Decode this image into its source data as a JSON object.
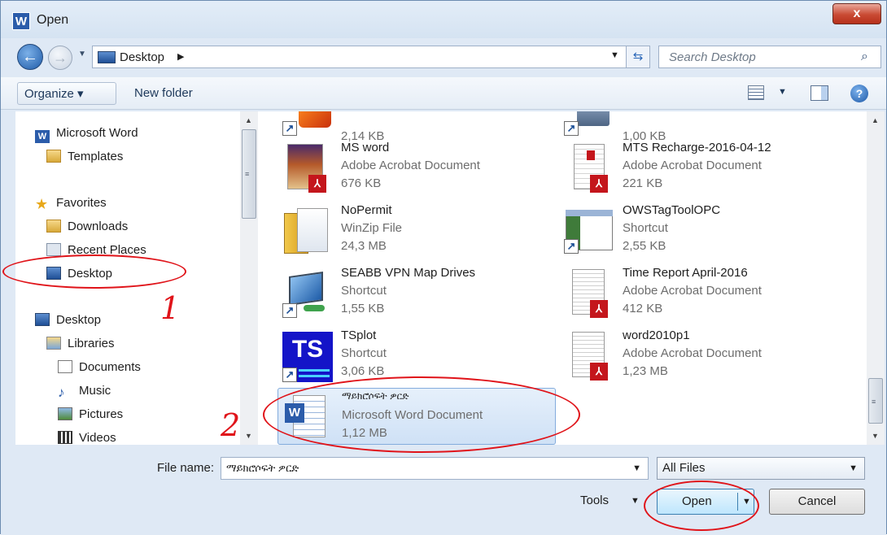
{
  "window": {
    "title": "Open",
    "app_icon_letter": "W",
    "close_symbol": "x"
  },
  "navigation": {
    "back_icon": "arrow-left",
    "forward_icon": "arrow-right",
    "address_path": "Desktop",
    "search_placeholder": "Search Desktop"
  },
  "toolbar": {
    "organize_label": "Organize ▾",
    "new_folder_label": "New folder"
  },
  "nav_tree": {
    "items": [
      {
        "label": "Microsoft Word",
        "icon": "word-app-icon"
      },
      {
        "label": "Templates",
        "icon": "folder-icon"
      },
      {
        "label": "Favorites",
        "icon": "star-icon"
      },
      {
        "label": "Downloads",
        "icon": "downloads-folder-icon"
      },
      {
        "label": "Recent Places",
        "icon": "recent-places-icon"
      },
      {
        "label": "Desktop",
        "icon": "desktop-icon",
        "selected": true
      },
      {
        "label": "Desktop",
        "icon": "desktop-icon"
      },
      {
        "label": "Libraries",
        "icon": "libraries-icon"
      },
      {
        "label": "Documents",
        "icon": "documents-icon"
      },
      {
        "label": "Music",
        "icon": "music-icon"
      },
      {
        "label": "Pictures",
        "icon": "pictures-icon"
      },
      {
        "label": "Videos",
        "icon": "videos-icon"
      }
    ]
  },
  "files": {
    "left": [
      {
        "name": "",
        "type": "",
        "size": "2,14 KB",
        "icon": "shortcut-icon"
      },
      {
        "name": "MS word",
        "type": "Adobe Acrobat Document",
        "size": "676 KB",
        "icon": "pdf-icon"
      },
      {
        "name": "NoPermit",
        "type": "WinZip File",
        "size": "24,3 MB",
        "icon": "winzip-icon"
      },
      {
        "name": "SEABB VPN Map Drives",
        "type": "Shortcut",
        "size": "1,55 KB",
        "icon": "network-shortcut-icon"
      },
      {
        "name": "TSplot",
        "type": "Shortcut",
        "size": "3,06 KB",
        "icon": "tsplot-icon"
      },
      {
        "name": "ማይክሮሶፍት ዎርድ",
        "type": "Microsoft Word Document",
        "size": "1,12 MB",
        "icon": "word-document-icon",
        "selected": true
      }
    ],
    "right": [
      {
        "name": "",
        "type": "",
        "size": "1,00 KB",
        "icon": "shortcut-icon"
      },
      {
        "name": "MTS Recharge-2016-04-12",
        "type": "Adobe Acrobat Document",
        "size": "221 KB",
        "icon": "pdf-icon"
      },
      {
        "name": "OWSTagToolOPC",
        "type": "Shortcut",
        "size": "2,55 KB",
        "icon": "app-shortcut-icon"
      },
      {
        "name": "Time Report April-2016",
        "type": "Adobe Acrobat Document",
        "size": "412 KB",
        "icon": "pdf-icon"
      },
      {
        "name": "word2010p1",
        "type": "Adobe Acrobat Document",
        "size": "1,23 MB",
        "icon": "pdf-icon"
      }
    ],
    "tsplot_badge": "TS",
    "pdf_badge": "⅄",
    "shortcut_arrow": "↗",
    "word_badge": "W"
  },
  "bottom": {
    "file_name_label": "File name:",
    "file_name_value": "ማይክሮሶፍት ዎርድ",
    "filter_value": "All Files",
    "tools_label": "Tools",
    "open_label": "Open",
    "cancel_label": "Cancel"
  },
  "annotations": {
    "mark_1": "1",
    "mark_2": "2",
    "color": "#e0141a"
  }
}
